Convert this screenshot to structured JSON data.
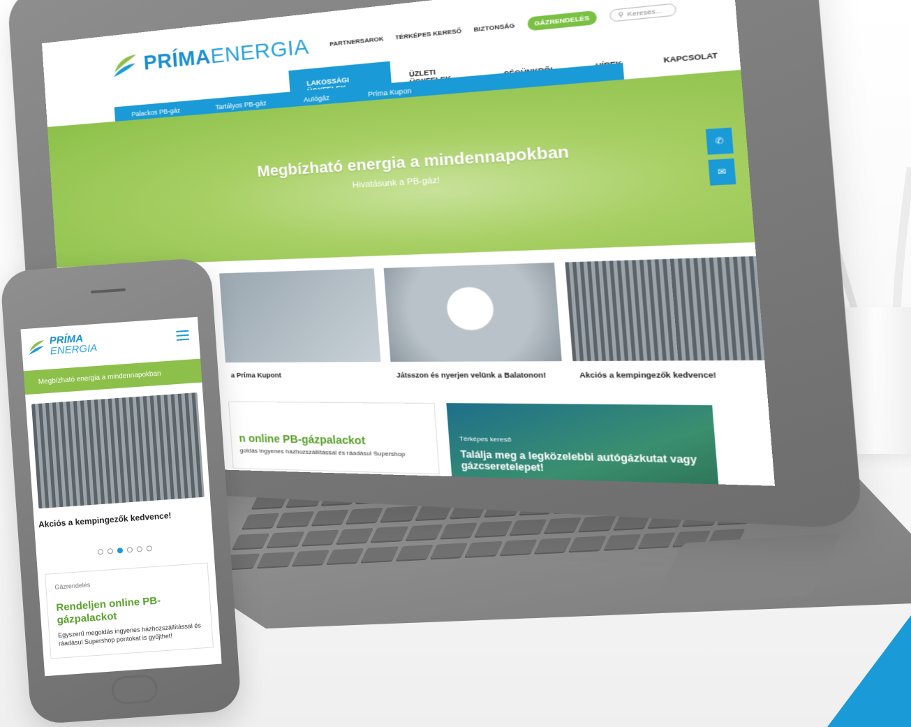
{
  "brand": {
    "name_bold": "PRÍMA",
    "name_light": "ENERGIA",
    "mobile_line1": "PRÍMA",
    "mobile_line2": "ENERGIA",
    "primary_color": "#1a9ad6",
    "accent_color": "#7ac143"
  },
  "top_links": [
    "PARTNERSAROK",
    "TÉRKÉPES KERESŐ",
    "BIZTONSÁG"
  ],
  "order_button": "GÁZRENDELÉS",
  "search": {
    "placeholder": "Keresés..."
  },
  "main_nav": [
    "LAKOSSÁGI ÜGYFELEK",
    "ÜZLETI ÜGYFELEK",
    "CÉGÜNKRŐL",
    "HÍREK",
    "KAPCSOLAT"
  ],
  "sub_nav": [
    "Palackos PB-gáz",
    "Tartályos PB-gáz",
    "Autógáz",
    "Príma Kupon"
  ],
  "hero": {
    "title": "Megbízható energia a mindennapokban",
    "subtitle": "Hivatásunk a PB-gáz!"
  },
  "cards": [
    {
      "caption": "a Príma Kupont"
    },
    {
      "caption": "Játsszon és nyerjen velünk a Balatonon!"
    },
    {
      "caption": "Akciós a kempingezők kedvence!"
    }
  ],
  "promo": {
    "title": "n online PB-gázpalackot",
    "text": "goldás ingyenes házhozszállítással és ráadásul Supershop"
  },
  "map_box": {
    "label": "Térképes kereső",
    "title": "Találja meg a legközelebbi autógázkutat vagy gázcseretelepet!"
  },
  "mobile": {
    "hero_text": "Megbízható energia a mindennapokban",
    "caption": "Akciós a kempingezők kedvence!",
    "slide_count": 6,
    "active_slide": 3,
    "card": {
      "label": "Gázrendelés",
      "title": "Rendeljen online PB-gázpalackot",
      "text": "Egyszerű megoldás ingyenes házhozszállítással és ráadásul Supershop pontokat is gyűjthet!"
    }
  },
  "icons": {
    "phone": "phone-icon",
    "mail": "mail-icon",
    "search": "search-icon",
    "menu": "hamburger-menu-icon"
  }
}
